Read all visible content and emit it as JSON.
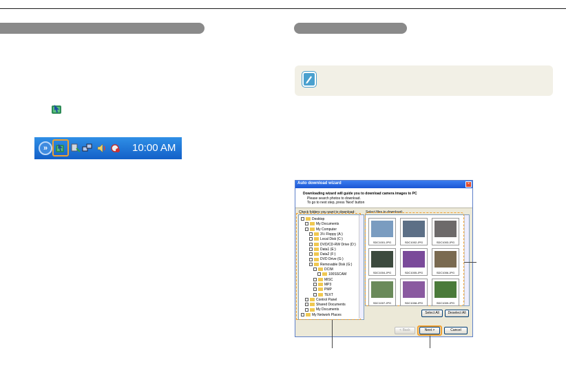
{
  "left": {
    "taskbar": {
      "clock": "10:00 AM",
      "expand_icon": "chevron-right-icon",
      "highlighted_icon": "intelli-studio-icon"
    }
  },
  "wizard": {
    "title": "Auto download wizard",
    "close": "×",
    "header_title": "Downloading wizard will guide you to download camera images to PC",
    "header_line1": "Please search photos to download.",
    "header_line2": "To go to next step, press 'Next' button",
    "folders_label": "Check folders you want to download:",
    "files_label": "Select files to download:",
    "tree": [
      {
        "label": "Desktop",
        "level": 0
      },
      {
        "label": "My Documents",
        "level": 1
      },
      {
        "label": "My Computer",
        "level": 1
      },
      {
        "label": "3½ Floppy (A:)",
        "level": 2
      },
      {
        "label": "Local Disk (C:)",
        "level": 2
      },
      {
        "label": "DVD/CD-RW Drive (D:)",
        "level": 2
      },
      {
        "label": "Data1 (E:)",
        "level": 2
      },
      {
        "label": "Data2 (F:)",
        "level": 2
      },
      {
        "label": "DVD Drive (G:)",
        "level": 2
      },
      {
        "label": "Removable Disk (G:)",
        "level": 2
      },
      {
        "label": "DCIM",
        "level": 3
      },
      {
        "label": "100SSCAM",
        "level": 4
      },
      {
        "label": "MISC",
        "level": 3
      },
      {
        "label": "MP3",
        "level": 3
      },
      {
        "label": "PMP",
        "level": 3
      },
      {
        "label": "TEXT",
        "level": 3
      },
      {
        "label": "Control Panel",
        "level": 1
      },
      {
        "label": "Shared Documents",
        "level": 1
      },
      {
        "label": "My Documents",
        "level": 1
      },
      {
        "label": "My Network Places",
        "level": 0
      }
    ],
    "thumbnails": [
      {
        "caption": "SDC1001.JPG",
        "color": "#7a9cc0"
      },
      {
        "caption": "SDC1002.JPG",
        "color": "#5c6f86"
      },
      {
        "caption": "SDC1003.JPG",
        "color": "#6d6a6a"
      },
      {
        "caption": "SDC1004.JPG",
        "color": "#3c4a3e"
      },
      {
        "caption": "SDC1005.JPG",
        "color": "#7a4a9a"
      },
      {
        "caption": "SDC1006.JPG",
        "color": "#7a6a50"
      },
      {
        "caption": "SDC1007.JPG",
        "color": "#6a8a5a"
      },
      {
        "caption": "SDC1008.JPG",
        "color": "#8a5aa0"
      },
      {
        "caption": "SDC1009.JPG",
        "color": "#4a7a3a"
      }
    ],
    "select_all": "Select All",
    "deselect_all": "Deselect All",
    "back": "< Back",
    "next": "Next >",
    "cancel": "Cancel"
  },
  "note": {
    "icon": "memo-pen-icon"
  }
}
